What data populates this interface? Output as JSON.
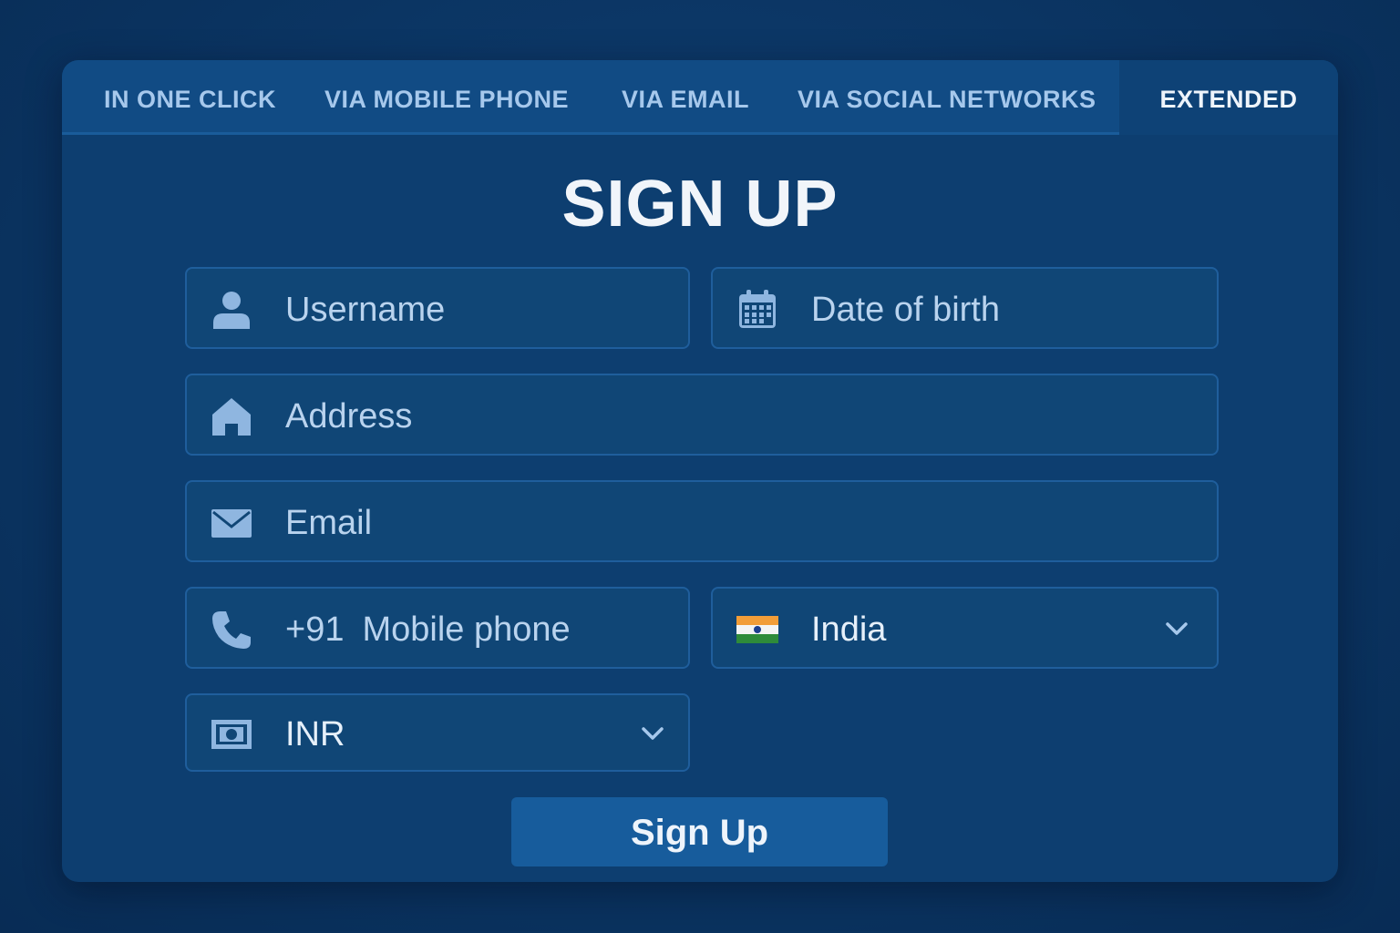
{
  "tabs": [
    {
      "label": "IN ONE CLICK",
      "active": false
    },
    {
      "label": "VIA MOBILE PHONE",
      "active": false
    },
    {
      "label": "VIA EMAIL",
      "active": false
    },
    {
      "label": "VIA SOCIAL NETWORKS",
      "active": false
    },
    {
      "label": "EXTENDED",
      "active": true
    }
  ],
  "form": {
    "title": "SIGN UP",
    "username": {
      "placeholder": "Username",
      "icon": "user-icon"
    },
    "date_of_birth": {
      "placeholder": "Date of birth",
      "icon": "calendar-icon"
    },
    "address": {
      "placeholder": "Address",
      "icon": "home-icon"
    },
    "email": {
      "placeholder": "Email",
      "icon": "envelope-icon"
    },
    "phone": {
      "code": "+91",
      "placeholder": "Mobile phone",
      "icon": "phone-icon"
    },
    "country": {
      "value": "India",
      "icon": "india-flag-icon"
    },
    "currency": {
      "value": "INR",
      "icon": "banknote-icon"
    },
    "submit_label": "Sign Up"
  },
  "colors": {
    "background": "#0b3563",
    "card": "#0d3e70",
    "tabbar": "#114b84",
    "field": "#104676",
    "field_border": "#1f5e9c",
    "icon": "#8fb6e0",
    "button": "#175c9c",
    "text_light": "#eef4fb"
  }
}
